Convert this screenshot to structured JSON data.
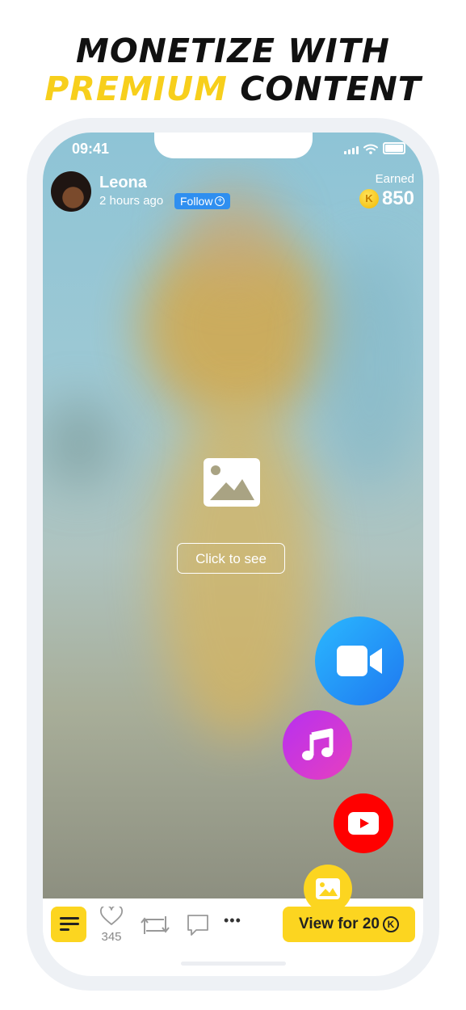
{
  "headline": {
    "line1": "MONETIZE WITH",
    "line2_accent": "PREMIUM",
    "line2_rest": " CONTENT"
  },
  "status_bar": {
    "time": "09:41"
  },
  "post": {
    "user_name": "Leona",
    "time_ago": "2 hours ago",
    "follow_label": "Follow",
    "earned_label": "Earned",
    "earned_value": "850",
    "coin_symbol": "K",
    "click_to_see_label": "Click to see"
  },
  "media_buttons": [
    {
      "name": "video",
      "icon": "video-camera-icon",
      "color": "#1f8ff5"
    },
    {
      "name": "music",
      "icon": "music-note-icon",
      "color": "#c836e0"
    },
    {
      "name": "youtube",
      "icon": "youtube-play-icon",
      "color": "#ff0000"
    },
    {
      "name": "image",
      "icon": "image-icon",
      "color": "#fcd520"
    }
  ],
  "bottom_bar": {
    "like_count": "345",
    "more_label": "•••",
    "view_label": "View for 20",
    "view_currency": "K"
  },
  "colors": {
    "accent_yellow": "#f7cf1c",
    "follow_blue": "#2f8ff0"
  }
}
